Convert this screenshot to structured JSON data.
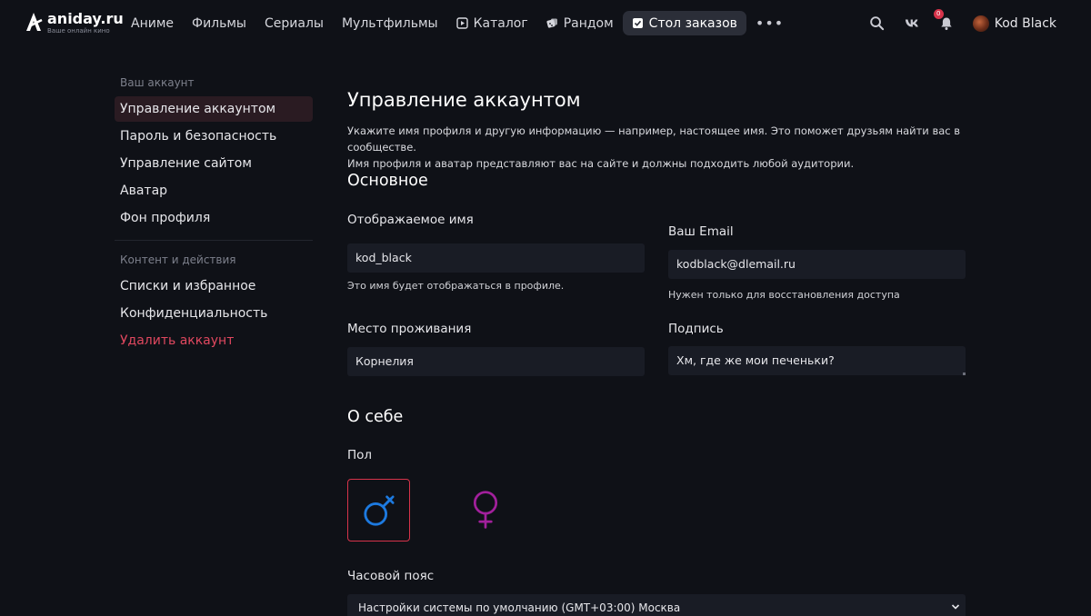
{
  "brand": {
    "name": "aniday.ru",
    "tagline": "Ваше онлайн кино"
  },
  "nav": {
    "items": [
      {
        "label": "Аниме"
      },
      {
        "label": "Фильмы"
      },
      {
        "label": "Сериалы"
      },
      {
        "label": "Мультфильмы"
      },
      {
        "label": "Каталог",
        "icon": "catalog-icon"
      },
      {
        "label": "Рандом",
        "icon": "dice-icon"
      },
      {
        "label": "Стол заказов",
        "icon": "orders-icon",
        "active": true
      }
    ],
    "more": "•••"
  },
  "topbar": {
    "notifications_count": "0",
    "user_name": "Kod Black",
    "icons": [
      "search-icon",
      "vk-icon",
      "bell-icon"
    ]
  },
  "sidebar": {
    "group1_title": "Ваш аккаунт",
    "group1": [
      {
        "label": "Управление аккаунтом",
        "active": true
      },
      {
        "label": "Пароль и безопасность"
      },
      {
        "label": "Управление сайтом"
      },
      {
        "label": "Аватар"
      },
      {
        "label": "Фон профиля"
      }
    ],
    "group2_title": "Контент и действия",
    "group2": [
      {
        "label": "Списки и избранное"
      },
      {
        "label": "Конфиденциальность"
      },
      {
        "label": "Удалить аккаунт",
        "danger": true
      }
    ]
  },
  "page": {
    "title": "Управление аккаунтом",
    "description_line1": "Укажите имя профиля и другую информацию — например, настоящее имя. Это поможет друзьям найти вас в сообществе.",
    "description_line2": "Имя профиля и аватар представляют вас на сайте и должны подходить любой аудитории."
  },
  "basic": {
    "title": "Основное",
    "display_name_label": "Отображаемое имя",
    "display_name_value": "kod_black",
    "display_name_hint": "Это имя будет отображаться в профиле.",
    "email_label": "Ваш Email",
    "email_value": "kodblack@dlemail.ru",
    "email_hint": "Нужен только для восстановления доступа",
    "location_label": "Место проживания",
    "location_value": "Корнелия",
    "signature_label": "Подпись",
    "signature_value": "Хм, где же мои печеньки?"
  },
  "about": {
    "title": "О себе",
    "gender_label": "Пол",
    "gender_selected": "male",
    "colors": {
      "male": "#1d7ae0",
      "female": "#a2209c",
      "selected_border": "#d6334a"
    },
    "timezone_label": "Часовой пояс",
    "timezone_value": "Настройки системы по умолчанию (GMT+03:00) Москва"
  },
  "theme": {
    "accent": "#d6334a",
    "background": "#0f1117",
    "input_bg": "#191c25"
  }
}
